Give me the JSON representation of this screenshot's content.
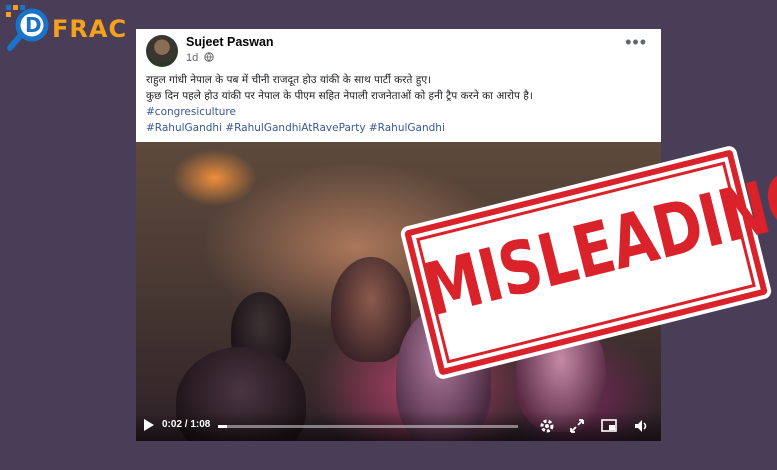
{
  "brand": {
    "logo_text": "FRAC"
  },
  "post": {
    "author": "Sujeet Paswan",
    "time": "1d",
    "more_label": "•••",
    "lines": [
      "राहुल गांधी नेपाल के पब में चीनी राजदूत होउ यांकी के साथ पार्टी करते हुए।",
      " कुछ दिन पहले होउ यांकी पर नेपाल के पीएम सहित नेपाली राजनेताओं को हनी ट्रैप करने का आरोप है।"
    ],
    "hashtags_line1": "#congresiculture",
    "hashtags_line2": "#RahulGandhi #RahulGandhiAtRaveParty #RahulGandhi"
  },
  "video": {
    "time_display": "0:02 / 1:08",
    "progress": 0.03
  },
  "stamp": {
    "text": "MISLEADING",
    "color": "#d9222a"
  },
  "colors": {
    "background": "#4a3d57",
    "link": "#385898",
    "logo_accent": "#f4a21c",
    "logo_blue": "#1b73c9"
  },
  "icons": [
    "play-icon",
    "settings-icon",
    "expand-icon",
    "picture-in-picture-icon",
    "volume-icon"
  ]
}
